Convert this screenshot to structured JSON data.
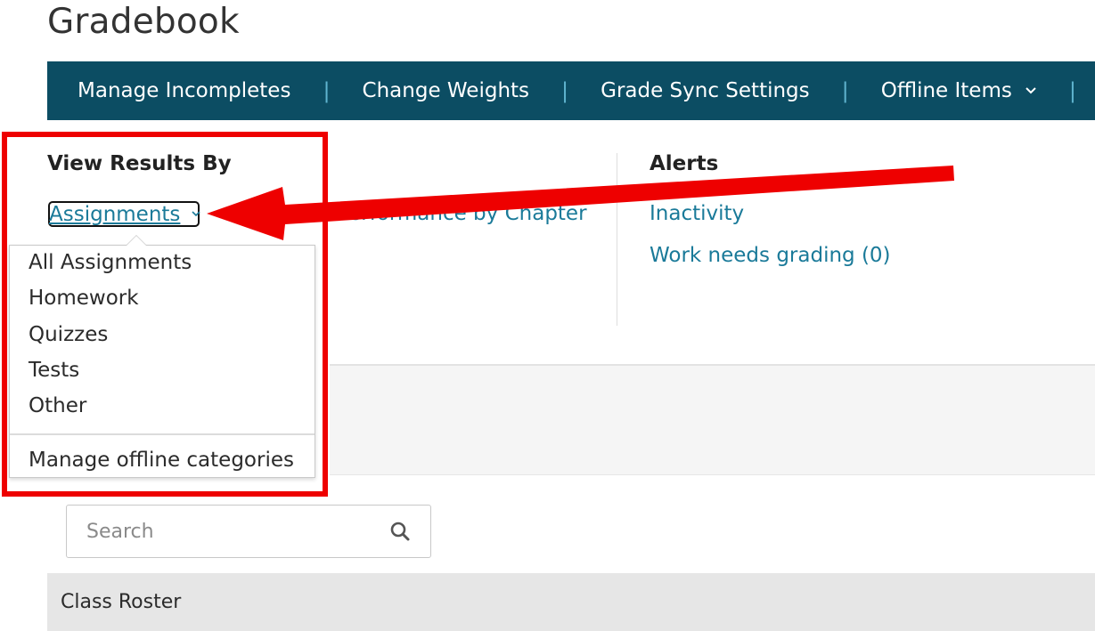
{
  "page": {
    "title": "Gradebook"
  },
  "navbar": {
    "items": [
      {
        "label": "Manage Incompletes"
      },
      {
        "label": "Change Weights"
      },
      {
        "label": "Grade Sync Settings"
      },
      {
        "label": "Offline Items"
      }
    ],
    "separator": "|"
  },
  "view_results": {
    "heading": "View Results By",
    "selected": "Assignments",
    "other_link": "Performance by Chapter"
  },
  "dropdown": {
    "options": [
      "All Assignments",
      "Homework",
      "Quizzes",
      "Tests",
      "Other"
    ],
    "manage_link": "Manage offline categories"
  },
  "alerts": {
    "heading": "Alerts",
    "links": [
      "Inactivity",
      "Work needs grading (0)"
    ]
  },
  "search": {
    "placeholder": "Search"
  },
  "roster": {
    "title": "Class Roster"
  },
  "colors": {
    "navbar_bg": "#0c4d63",
    "link": "#1a7a99",
    "annotation_red": "#ee0000"
  },
  "icons": {
    "nav_dropdown": "chevron-down-icon",
    "assignments_dropdown": "chevron-down-icon",
    "search": "search-icon"
  }
}
